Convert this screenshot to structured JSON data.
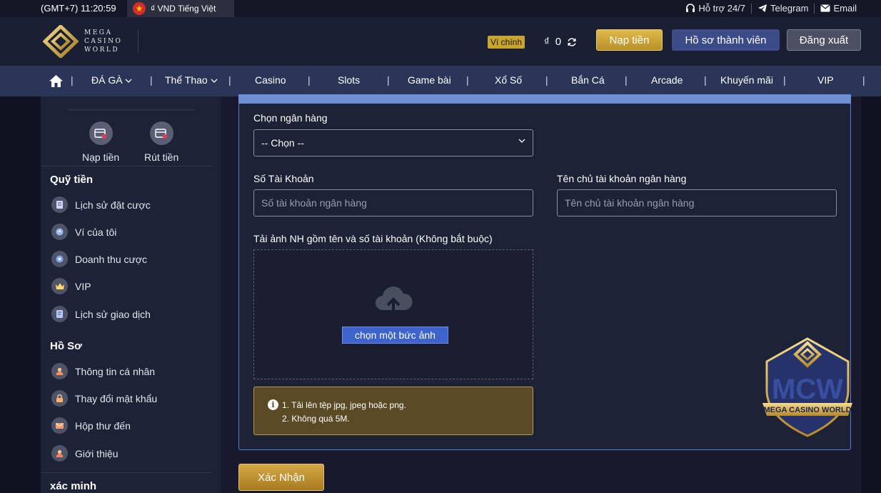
{
  "topbar": {
    "clock": "(GMT+7) 11:20:59",
    "language": "₫ VND Tiếng Việt",
    "support": "Hỗ trợ 24/7",
    "telegram": "Telegram",
    "email": "Email"
  },
  "header": {
    "logo_lines": [
      "MEGA",
      "CASINO",
      "WORLD"
    ],
    "wallet_badge": "Ví chính",
    "currency": "₫",
    "balance": "0",
    "deposit_button": "Nạp tiền",
    "profile_button": "Hồ sơ thành viên",
    "logout_button": "Đăng xuất"
  },
  "nav": [
    "ĐÁ GÀ",
    "Thể Thao",
    "Casino",
    "Slots",
    "Game bài",
    "Xổ Số",
    "Bắn Cá",
    "Arcade",
    "Khuyến mãi",
    "VIP"
  ],
  "sidebar": {
    "quick_actions": [
      "Nạp tiền",
      "Rút tiền"
    ],
    "section_funds": "Quỹ tiền",
    "funds_items": [
      "Lịch sử đặt cược",
      "Ví của tôi",
      "Doanh thu cược",
      "VIP",
      "Lịch sử giao dịch"
    ],
    "section_profile": "Hồ Sơ",
    "profile_items": [
      "Thông tin cá nhân",
      "Thay đổi mật khẩu",
      "Hộp thư đến",
      "Giới thiệu"
    ],
    "section_verify": "xác minh"
  },
  "form": {
    "bank_label": "Chọn ngân hàng",
    "bank_selected": "-- Chọn --",
    "account_number_label": "Số Tài Khoản",
    "account_number_placeholder": "Số tài khoản ngân hàng",
    "account_name_label": "Tên chủ tài khoản ngân hàng",
    "account_name_placeholder": "Tên chủ tài khoản ngân hàng",
    "upload_label": "Tải ảnh NH gồm tên và số tài khoản (Không bắt buộc)",
    "upload_button": "chọn một bức ảnh",
    "note_line1": "1. Tải lên tệp jpg, jpeg hoặc png.",
    "note_line2": "2. Không quá 5M.",
    "submit_button": "Xác Nhận"
  },
  "watermark": {
    "big": "MCW",
    "ribbon": "MEGA CASINO WORLD"
  },
  "colors": {
    "gold": "#c8a52f",
    "nav_bg": "#2a3557",
    "accent_blue": "#3e63cc"
  }
}
